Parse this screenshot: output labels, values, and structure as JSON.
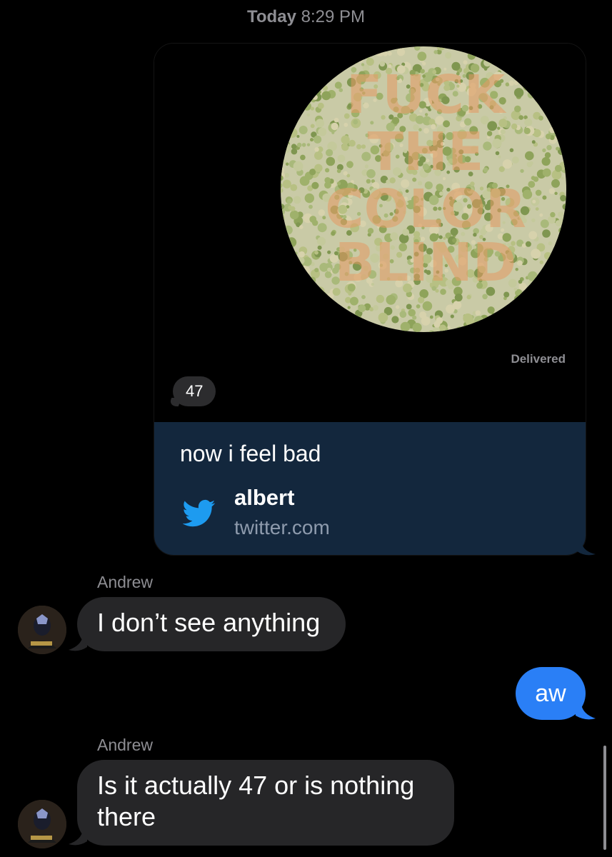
{
  "conversation": {
    "timestamp_day": "Today",
    "timestamp_time": "8:29 PM"
  },
  "link_card": {
    "status": "Delivered",
    "reply_count": "47",
    "message_text": "now i feel bad",
    "link_title": "albert",
    "link_domain": "twitter.com",
    "image_icon": "color-blindness-test-plate",
    "image_text": "FUCK THE COLOR BLIND"
  },
  "messages": [
    {
      "sender": "Andrew",
      "text": "I don’t see anything"
    },
    {
      "text": "aw"
    },
    {
      "sender": "Andrew",
      "line1": "Is it actually 47 or is nothing",
      "line2": "there"
    }
  ],
  "colors": {
    "background": "#000000",
    "incoming_bubble": "#262628",
    "outgoing_bubble": "#2a7ff6",
    "link_footer": "#13273d",
    "twitter_blue": "#1d9bf0"
  }
}
